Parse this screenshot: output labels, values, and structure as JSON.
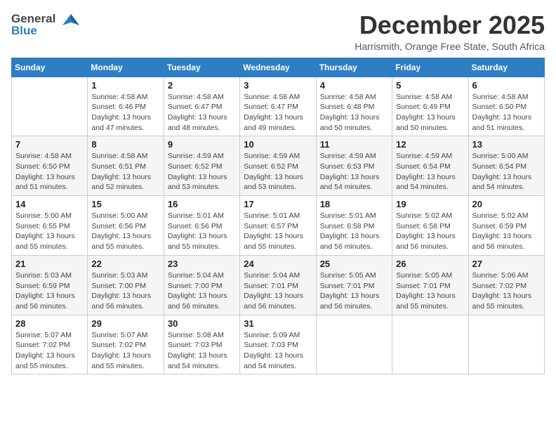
{
  "logo": {
    "general": "General",
    "blue": "Blue"
  },
  "title": "December 2025",
  "location": "Harrismith, Orange Free State, South Africa",
  "weekdays": [
    "Sunday",
    "Monday",
    "Tuesday",
    "Wednesday",
    "Thursday",
    "Friday",
    "Saturday"
  ],
  "weeks": [
    [
      {
        "day": "",
        "info": ""
      },
      {
        "day": "1",
        "info": "Sunrise: 4:58 AM\nSunset: 6:46 PM\nDaylight: 13 hours\nand 47 minutes."
      },
      {
        "day": "2",
        "info": "Sunrise: 4:58 AM\nSunset: 6:47 PM\nDaylight: 13 hours\nand 48 minutes."
      },
      {
        "day": "3",
        "info": "Sunrise: 4:58 AM\nSunset: 6:47 PM\nDaylight: 13 hours\nand 49 minutes."
      },
      {
        "day": "4",
        "info": "Sunrise: 4:58 AM\nSunset: 6:48 PM\nDaylight: 13 hours\nand 50 minutes."
      },
      {
        "day": "5",
        "info": "Sunrise: 4:58 AM\nSunset: 6:49 PM\nDaylight: 13 hours\nand 50 minutes."
      },
      {
        "day": "6",
        "info": "Sunrise: 4:58 AM\nSunset: 6:50 PM\nDaylight: 13 hours\nand 51 minutes."
      }
    ],
    [
      {
        "day": "7",
        "info": "Sunrise: 4:58 AM\nSunset: 6:50 PM\nDaylight: 13 hours\nand 51 minutes."
      },
      {
        "day": "8",
        "info": "Sunrise: 4:58 AM\nSunset: 6:51 PM\nDaylight: 13 hours\nand 52 minutes."
      },
      {
        "day": "9",
        "info": "Sunrise: 4:59 AM\nSunset: 6:52 PM\nDaylight: 13 hours\nand 53 minutes."
      },
      {
        "day": "10",
        "info": "Sunrise: 4:59 AM\nSunset: 6:52 PM\nDaylight: 13 hours\nand 53 minutes."
      },
      {
        "day": "11",
        "info": "Sunrise: 4:59 AM\nSunset: 6:53 PM\nDaylight: 13 hours\nand 54 minutes."
      },
      {
        "day": "12",
        "info": "Sunrise: 4:59 AM\nSunset: 6:54 PM\nDaylight: 13 hours\nand 54 minutes."
      },
      {
        "day": "13",
        "info": "Sunrise: 5:00 AM\nSunset: 6:54 PM\nDaylight: 13 hours\nand 54 minutes."
      }
    ],
    [
      {
        "day": "14",
        "info": "Sunrise: 5:00 AM\nSunset: 6:55 PM\nDaylight: 13 hours\nand 55 minutes."
      },
      {
        "day": "15",
        "info": "Sunrise: 5:00 AM\nSunset: 6:56 PM\nDaylight: 13 hours\nand 55 minutes."
      },
      {
        "day": "16",
        "info": "Sunrise: 5:01 AM\nSunset: 6:56 PM\nDaylight: 13 hours\nand 55 minutes."
      },
      {
        "day": "17",
        "info": "Sunrise: 5:01 AM\nSunset: 6:57 PM\nDaylight: 13 hours\nand 55 minutes."
      },
      {
        "day": "18",
        "info": "Sunrise: 5:01 AM\nSunset: 6:58 PM\nDaylight: 13 hours\nand 56 minutes."
      },
      {
        "day": "19",
        "info": "Sunrise: 5:02 AM\nSunset: 6:58 PM\nDaylight: 13 hours\nand 56 minutes."
      },
      {
        "day": "20",
        "info": "Sunrise: 5:02 AM\nSunset: 6:59 PM\nDaylight: 13 hours\nand 56 minutes."
      }
    ],
    [
      {
        "day": "21",
        "info": "Sunrise: 5:03 AM\nSunset: 6:59 PM\nDaylight: 13 hours\nand 56 minutes."
      },
      {
        "day": "22",
        "info": "Sunrise: 5:03 AM\nSunset: 7:00 PM\nDaylight: 13 hours\nand 56 minutes."
      },
      {
        "day": "23",
        "info": "Sunrise: 5:04 AM\nSunset: 7:00 PM\nDaylight: 13 hours\nand 56 minutes."
      },
      {
        "day": "24",
        "info": "Sunrise: 5:04 AM\nSunset: 7:01 PM\nDaylight: 13 hours\nand 56 minutes."
      },
      {
        "day": "25",
        "info": "Sunrise: 5:05 AM\nSunset: 7:01 PM\nDaylight: 13 hours\nand 56 minutes."
      },
      {
        "day": "26",
        "info": "Sunrise: 5:05 AM\nSunset: 7:01 PM\nDaylight: 13 hours\nand 55 minutes."
      },
      {
        "day": "27",
        "info": "Sunrise: 5:06 AM\nSunset: 7:02 PM\nDaylight: 13 hours\nand 55 minutes."
      }
    ],
    [
      {
        "day": "28",
        "info": "Sunrise: 5:07 AM\nSunset: 7:02 PM\nDaylight: 13 hours\nand 55 minutes."
      },
      {
        "day": "29",
        "info": "Sunrise: 5:07 AM\nSunset: 7:02 PM\nDaylight: 13 hours\nand 55 minutes."
      },
      {
        "day": "30",
        "info": "Sunrise: 5:08 AM\nSunset: 7:03 PM\nDaylight: 13 hours\nand 54 minutes."
      },
      {
        "day": "31",
        "info": "Sunrise: 5:09 AM\nSunset: 7:03 PM\nDaylight: 13 hours\nand 54 minutes."
      },
      {
        "day": "",
        "info": ""
      },
      {
        "day": "",
        "info": ""
      },
      {
        "day": "",
        "info": ""
      }
    ]
  ]
}
